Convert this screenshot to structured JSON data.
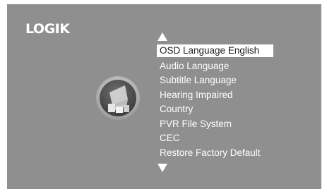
{
  "brand": {
    "logo": "LOGIK"
  },
  "menu": {
    "items": [
      {
        "label": "OSD Language English",
        "selected": true
      },
      {
        "label": "Audio Language",
        "selected": false
      },
      {
        "label": "Subtitle Language",
        "selected": false
      },
      {
        "label": "Hearing Impaired",
        "selected": false
      },
      {
        "label": "Country",
        "selected": false
      },
      {
        "label": "PVR File System",
        "selected": false
      },
      {
        "label": "CEC",
        "selected": false
      },
      {
        "label": "Restore Factory Default",
        "selected": false
      }
    ]
  },
  "icons": {
    "category": "setup-icon",
    "scroll_up": "up-arrow-icon",
    "scroll_down": "down-arrow-icon"
  },
  "colors": {
    "background": "#8f8f8f",
    "text": "#ffffff",
    "highlight": "#ffffff",
    "highlight_text": "#222222"
  }
}
